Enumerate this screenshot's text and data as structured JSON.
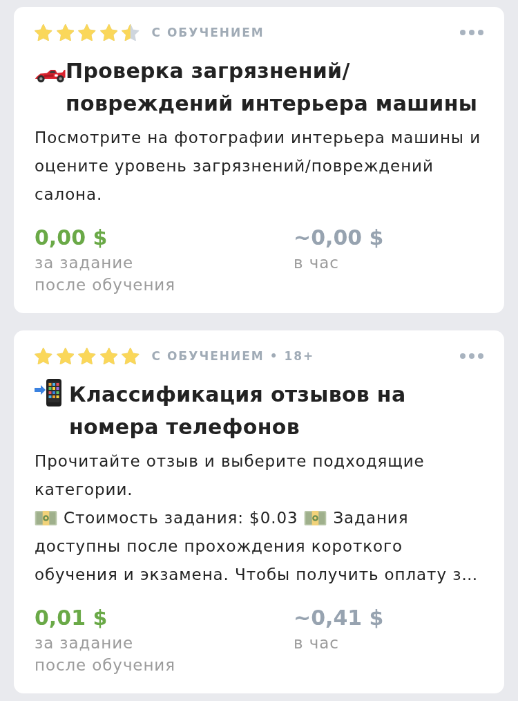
{
  "cards": [
    {
      "stars": 4.5,
      "tag": "С ОБУЧЕНИЕМ",
      "title": {
        "icon": {
          "kind": "race_car"
        },
        "text": "Проверка загрязнений/повреждений интерьера машины"
      },
      "description": [
        {
          "parts": [
            {
              "kind": "text",
              "text": "Посмотрите на фотографии интерьера машины и оцените уровень загрязнений/повреждений салона."
            }
          ]
        }
      ],
      "rates": [
        {
          "kind": "per_task",
          "amount": "0,00 $",
          "notes": [
            "за задание",
            "после обучения"
          ]
        },
        {
          "kind": "per_hour",
          "amount": "~0,00 $",
          "notes": [
            "в час"
          ]
        }
      ]
    },
    {
      "stars": 5,
      "tag": "С ОБУЧЕНИЕМ • 18+",
      "title": {
        "icon": {
          "kind": "phone_arrow"
        },
        "text": "Классификация отзывов на номера телефонов"
      },
      "description": [
        {
          "parts": [
            {
              "kind": "text",
              "text": "Прочитайте отзыв и выберите подходящие категории."
            }
          ]
        },
        {
          "parts": [
            {
              "kind": "banknote"
            },
            {
              "kind": "text",
              "text": "Стоимость задания: $0.03"
            },
            {
              "kind": "banknote"
            },
            {
              "kind": "text",
              "text": "Задания доступны после прохождения короткого обучения и экзамена. Чтобы получить оплату з…"
            }
          ]
        }
      ],
      "rates": [
        {
          "kind": "per_task",
          "amount": "0,01 $",
          "notes": [
            "за задание",
            "после обучения"
          ]
        },
        {
          "kind": "per_hour",
          "amount": "~0,41 $",
          "notes": [
            "в час"
          ]
        }
      ]
    }
  ]
}
